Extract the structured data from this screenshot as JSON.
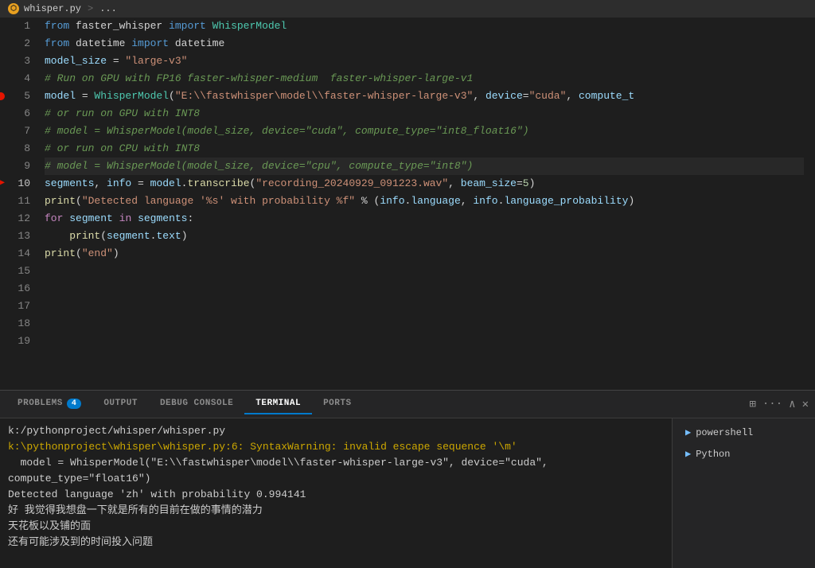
{
  "titlebar": {
    "filename": "whisper.py",
    "separator": ">",
    "breadcrumb": "..."
  },
  "editor": {
    "lines": [
      {
        "num": 1,
        "content": "<span class='kw'>from</span> faster_whisper <span class='kw'>import</span> <span class='cls'>WhisperModel</span>"
      },
      {
        "num": 2,
        "content": "<span class='kw'>from</span> datetime <span class='kw'>import</span> datetime"
      },
      {
        "num": 3,
        "content": "<span class='var'>model_size</span> = <span class='str'>\"large-v3\"</span>"
      },
      {
        "num": 4,
        "content": ""
      },
      {
        "num": 5,
        "content": "<span class='comment'># Run on GPU with FP16 faster-whisper-medium  faster-whisper-large-v1</span>",
        "breakpoint": true
      },
      {
        "num": 6,
        "content": "<span class='var'>model</span> = <span class='cls'>WhisperModel</span>(<span class='str'>\"E:\\\\fastwhisper\\model\\\\faster-whisper-large-v3\"</span>, <span class='param'>device</span>=<span class='str'>\"cuda\"</span>, <span class='param'>compute_t</span>"
      },
      {
        "num": 7,
        "content": "<span class='comment'># or run on GPU with INT8</span>"
      },
      {
        "num": 8,
        "content": "<span class='comment'># model = WhisperModel(model_size, device=\"cuda\", compute_type=\"int8_float16\")</span>"
      },
      {
        "num": 9,
        "content": "<span class='comment'># or run on CPU with INT8</span>"
      },
      {
        "num": 10,
        "content": "<span class='comment'># model = WhisperModel(model_size, device=\"cpu\", compute_type=\"int8\")</span>",
        "error": true,
        "active": true
      },
      {
        "num": 11,
        "content": ""
      },
      {
        "num": 12,
        "content": "<span class='var'>segments</span>, <span class='var'>info</span> = <span class='var'>model</span>.<span class='fn'>transcribe</span>(<span class='str'>\"recording_20240929_091223.wav\"</span>, <span class='param'>beam_size</span>=<span class='num'>5</span>)"
      },
      {
        "num": 13,
        "content": ""
      },
      {
        "num": 14,
        "content": "<span class='fn'>print</span>(<span class='str'>\"Detected language '%s' with probability %f\"</span> % (<span class='var'>info</span>.<span class='prop'>language</span>, <span class='var'>info</span>.<span class='prop'>language_probability</span>)"
      },
      {
        "num": 15,
        "content": ""
      },
      {
        "num": 16,
        "content": "<span class='kw2'>for</span> <span class='var'>segment</span> <span class='kw2'>in</span> <span class='var'>segments</span>:"
      },
      {
        "num": 17,
        "content": "    <span class='fn'>print</span>(<span class='var'>segment</span>.<span class='prop'>text</span>)"
      },
      {
        "num": 18,
        "content": ""
      },
      {
        "num": 19,
        "content": "<span class='fn'>print</span>(<span class='str'>\"end\"</span>)"
      }
    ]
  },
  "panel": {
    "tabs": [
      {
        "id": "problems",
        "label": "PROBLEMS",
        "badge": "4",
        "active": false
      },
      {
        "id": "output",
        "label": "OUTPUT",
        "active": false
      },
      {
        "id": "debug",
        "label": "DEBUG CONSOLE",
        "active": false
      },
      {
        "id": "terminal",
        "label": "TERMINAL",
        "active": true
      },
      {
        "id": "ports",
        "label": "PORTS",
        "active": false
      }
    ],
    "terminal_lines": [
      "k:/pythonproject/whisper/whisper.py",
      "k:\\pythonproject\\whisper\\whisper.py:6: SyntaxWarning: invalid escape sequence '\\m'",
      "  model = WhisperModel(\"E:\\\\fastwhisper\\model\\\\faster-whisper-large-v3\", device=\"cuda\",",
      "compute_type=\"float16\")",
      "Detected language 'zh' with probability 0.994141",
      "好 我觉得我想盘一下就是所有的目前在做的事情的潜力",
      "天花板以及铺的面",
      "还有可能涉及到的时间投入问题"
    ],
    "sessions": [
      {
        "label": "powershell",
        "icon": "▶"
      },
      {
        "label": "Python",
        "icon": "▶"
      }
    ]
  }
}
